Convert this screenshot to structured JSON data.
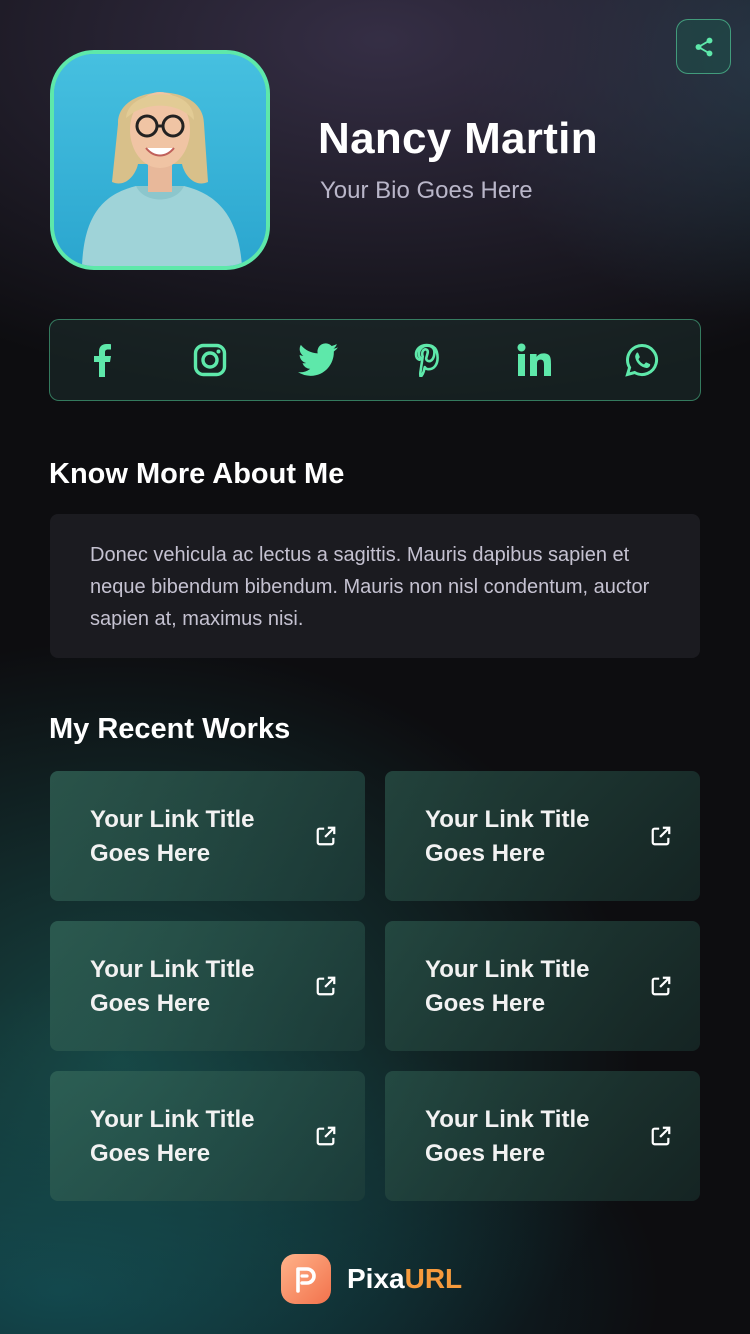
{
  "profile": {
    "name": "Nancy Martin",
    "bio": "Your Bio Goes Here"
  },
  "share": {
    "icon": "share-icon"
  },
  "social": [
    {
      "icon": "facebook-icon"
    },
    {
      "icon": "instagram-icon"
    },
    {
      "icon": "twitter-icon"
    },
    {
      "icon": "pinterest-icon"
    },
    {
      "icon": "linkedin-icon"
    },
    {
      "icon": "whatsapp-icon"
    }
  ],
  "about": {
    "title": "Know More About Me",
    "text": "Donec vehicula ac lectus a sagittis. Mauris dapibus sapien et neque bibendum bibendum. Mauris non nisl condentum, auctor sapien at, maximus nisi."
  },
  "works": {
    "title": "My Recent Works",
    "items": [
      {
        "title": "Your Link Title Goes Here"
      },
      {
        "title": "Your Link Title Goes Here"
      },
      {
        "title": "Your Link Title Goes Here"
      },
      {
        "title": "Your Link Title Goes Here"
      },
      {
        "title": "Your Link Title Goes Here"
      },
      {
        "title": "Your Link Title Goes Here"
      }
    ]
  },
  "footer": {
    "brand_primary": "Pixa",
    "brand_accent": "URL"
  },
  "colors": {
    "accent": "#5ee8aa",
    "brand_orange": "#f79a3c",
    "background": "#0d0d10"
  }
}
